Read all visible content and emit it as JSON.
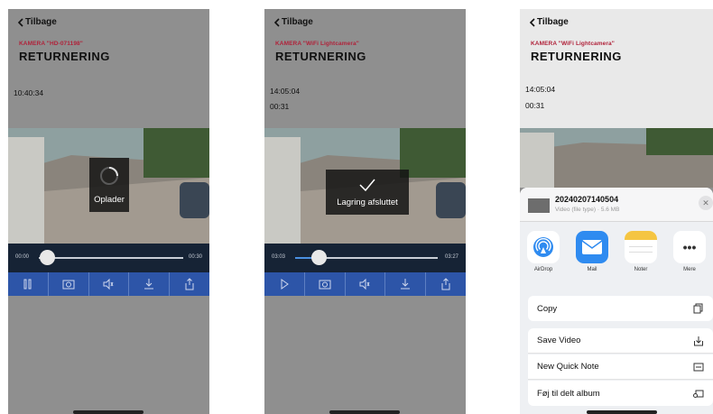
{
  "nav": {
    "back_label": "Tilbage"
  },
  "screens": [
    {
      "camera": "KAMERA \"HD-071198\"",
      "title": "RETURNERING",
      "time": "10:40:34",
      "elapsed": "",
      "overlay": "Oplader",
      "scrub": {
        "start": "00:00",
        "end": "00:30",
        "progress": 0.0
      }
    },
    {
      "camera": "KAMERA \"WiFi Lightcamera\"",
      "title": "RETURNERING",
      "time": "14:05:04",
      "elapsed": "00:31",
      "overlay": "Lagring afsluttet",
      "scrub": {
        "start": "03:03",
        "end": "03:27",
        "progress": 0.08
      }
    },
    {
      "camera": "KAMERA \"WiFi Lightcamera\"",
      "title": "RETURNERING",
      "time": "14:05:04",
      "elapsed": "00:31"
    }
  ],
  "share": {
    "file_name": "20240207140504",
    "file_sub": "Video (file type) · 5.6 MB",
    "apps": [
      {
        "label": "AirDrop",
        "icon": "airdrop-icon"
      },
      {
        "label": "Mail",
        "icon": "mail-icon"
      },
      {
        "label": "Noter",
        "icon": "notes-icon"
      },
      {
        "label": "Mere",
        "icon": "more-icon"
      }
    ],
    "actions": [
      {
        "label": "Copy",
        "icon": "copy-icon"
      },
      {
        "label": "Save Video",
        "icon": "save-icon"
      },
      {
        "label": "New Quick Note",
        "icon": "quick-note-icon"
      },
      {
        "label": "Føj til delt album",
        "icon": "shared-album-icon"
      }
    ]
  },
  "colors": {
    "accent": "#2d55a8",
    "camera_label": "#b0223a",
    "scrub_bg": "#162335"
  }
}
